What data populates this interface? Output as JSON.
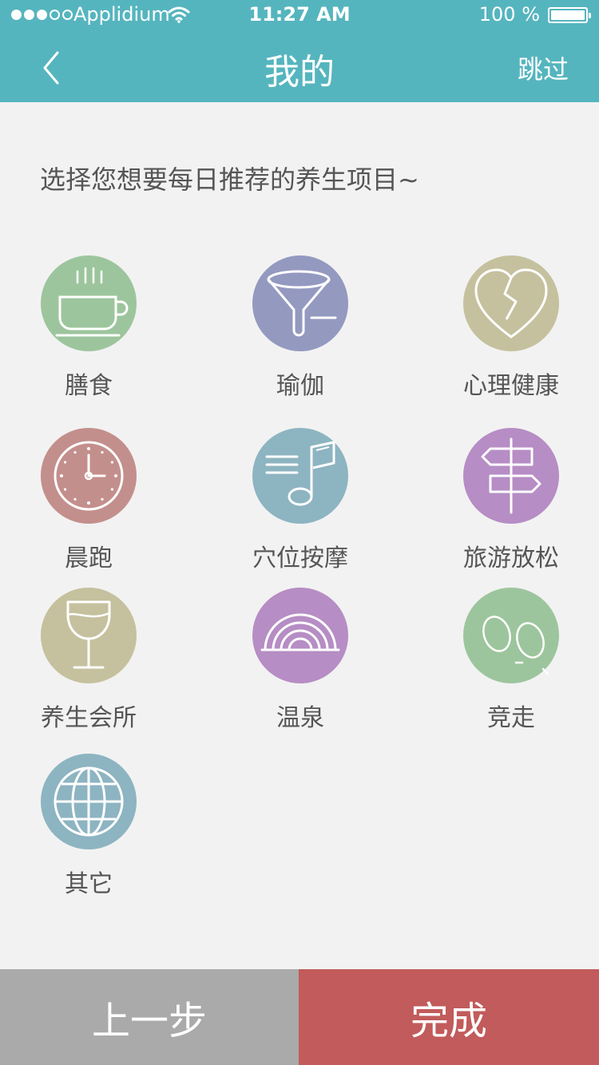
{
  "status": {
    "carrier": "Applidium",
    "time": "11:27 AM",
    "battery_text": "100 %"
  },
  "nav": {
    "title": "我的",
    "skip": "跳过"
  },
  "prompt": "选择您想要每日推荐的养生项目~",
  "items": [
    {
      "label": "膳食",
      "icon": "coffee-cup-icon",
      "color": "#9dc59d"
    },
    {
      "label": "瑜伽",
      "icon": "funnel-icon",
      "color": "#9499c0"
    },
    {
      "label": "心理健康",
      "icon": "broken-heart-icon",
      "color": "#c5c19e"
    },
    {
      "label": "晨跑",
      "icon": "clock-icon",
      "color": "#c38f8c"
    },
    {
      "label": "穴位按摩",
      "icon": "music-note-icon",
      "color": "#8db4c1"
    },
    {
      "label": "旅游放松",
      "icon": "signpost-icon",
      "color": "#b68dc4"
    },
    {
      "label": "养生会所",
      "icon": "wine-glass-icon",
      "color": "#c5c19e"
    },
    {
      "label": "温泉",
      "icon": "rainbow-icon",
      "color": "#b68dc4"
    },
    {
      "label": "竞走",
      "icon": "footprints-icon",
      "color": "#9dc59d"
    },
    {
      "label": "其它",
      "icon": "globe-icon",
      "color": "#8db4c1"
    }
  ],
  "buttons": {
    "prev": "上一步",
    "done": "完成"
  },
  "colors": {
    "header": "#55b5be",
    "prev_button": "#aaaaaa",
    "done_button": "#c25b5b"
  }
}
